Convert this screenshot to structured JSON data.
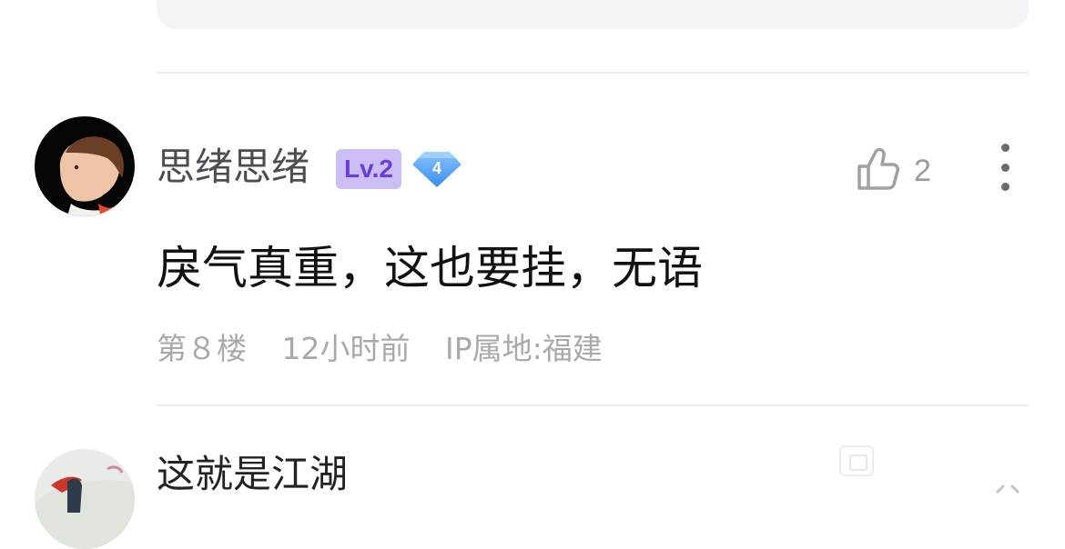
{
  "comment": {
    "username": "思绪思绪",
    "level_badge": "Lv.2",
    "fan_badge_number": "4",
    "like_count": "2",
    "text": "戾气真重，这也要挂，无语",
    "floor": "第８楼",
    "time": "12小时前",
    "ip_location": "IP属地:福建"
  },
  "next_comment": {
    "username": "这就是江湖"
  },
  "colors": {
    "level_badge_bg": "#cdbdf5",
    "level_badge_text": "#6a3fd6",
    "fan_badge": "#5b9ff5",
    "meta_text": "#a8a8ae"
  },
  "icons": [
    "thumbs-up-icon",
    "more-vertical-icon",
    "diamond-badge-icon"
  ]
}
